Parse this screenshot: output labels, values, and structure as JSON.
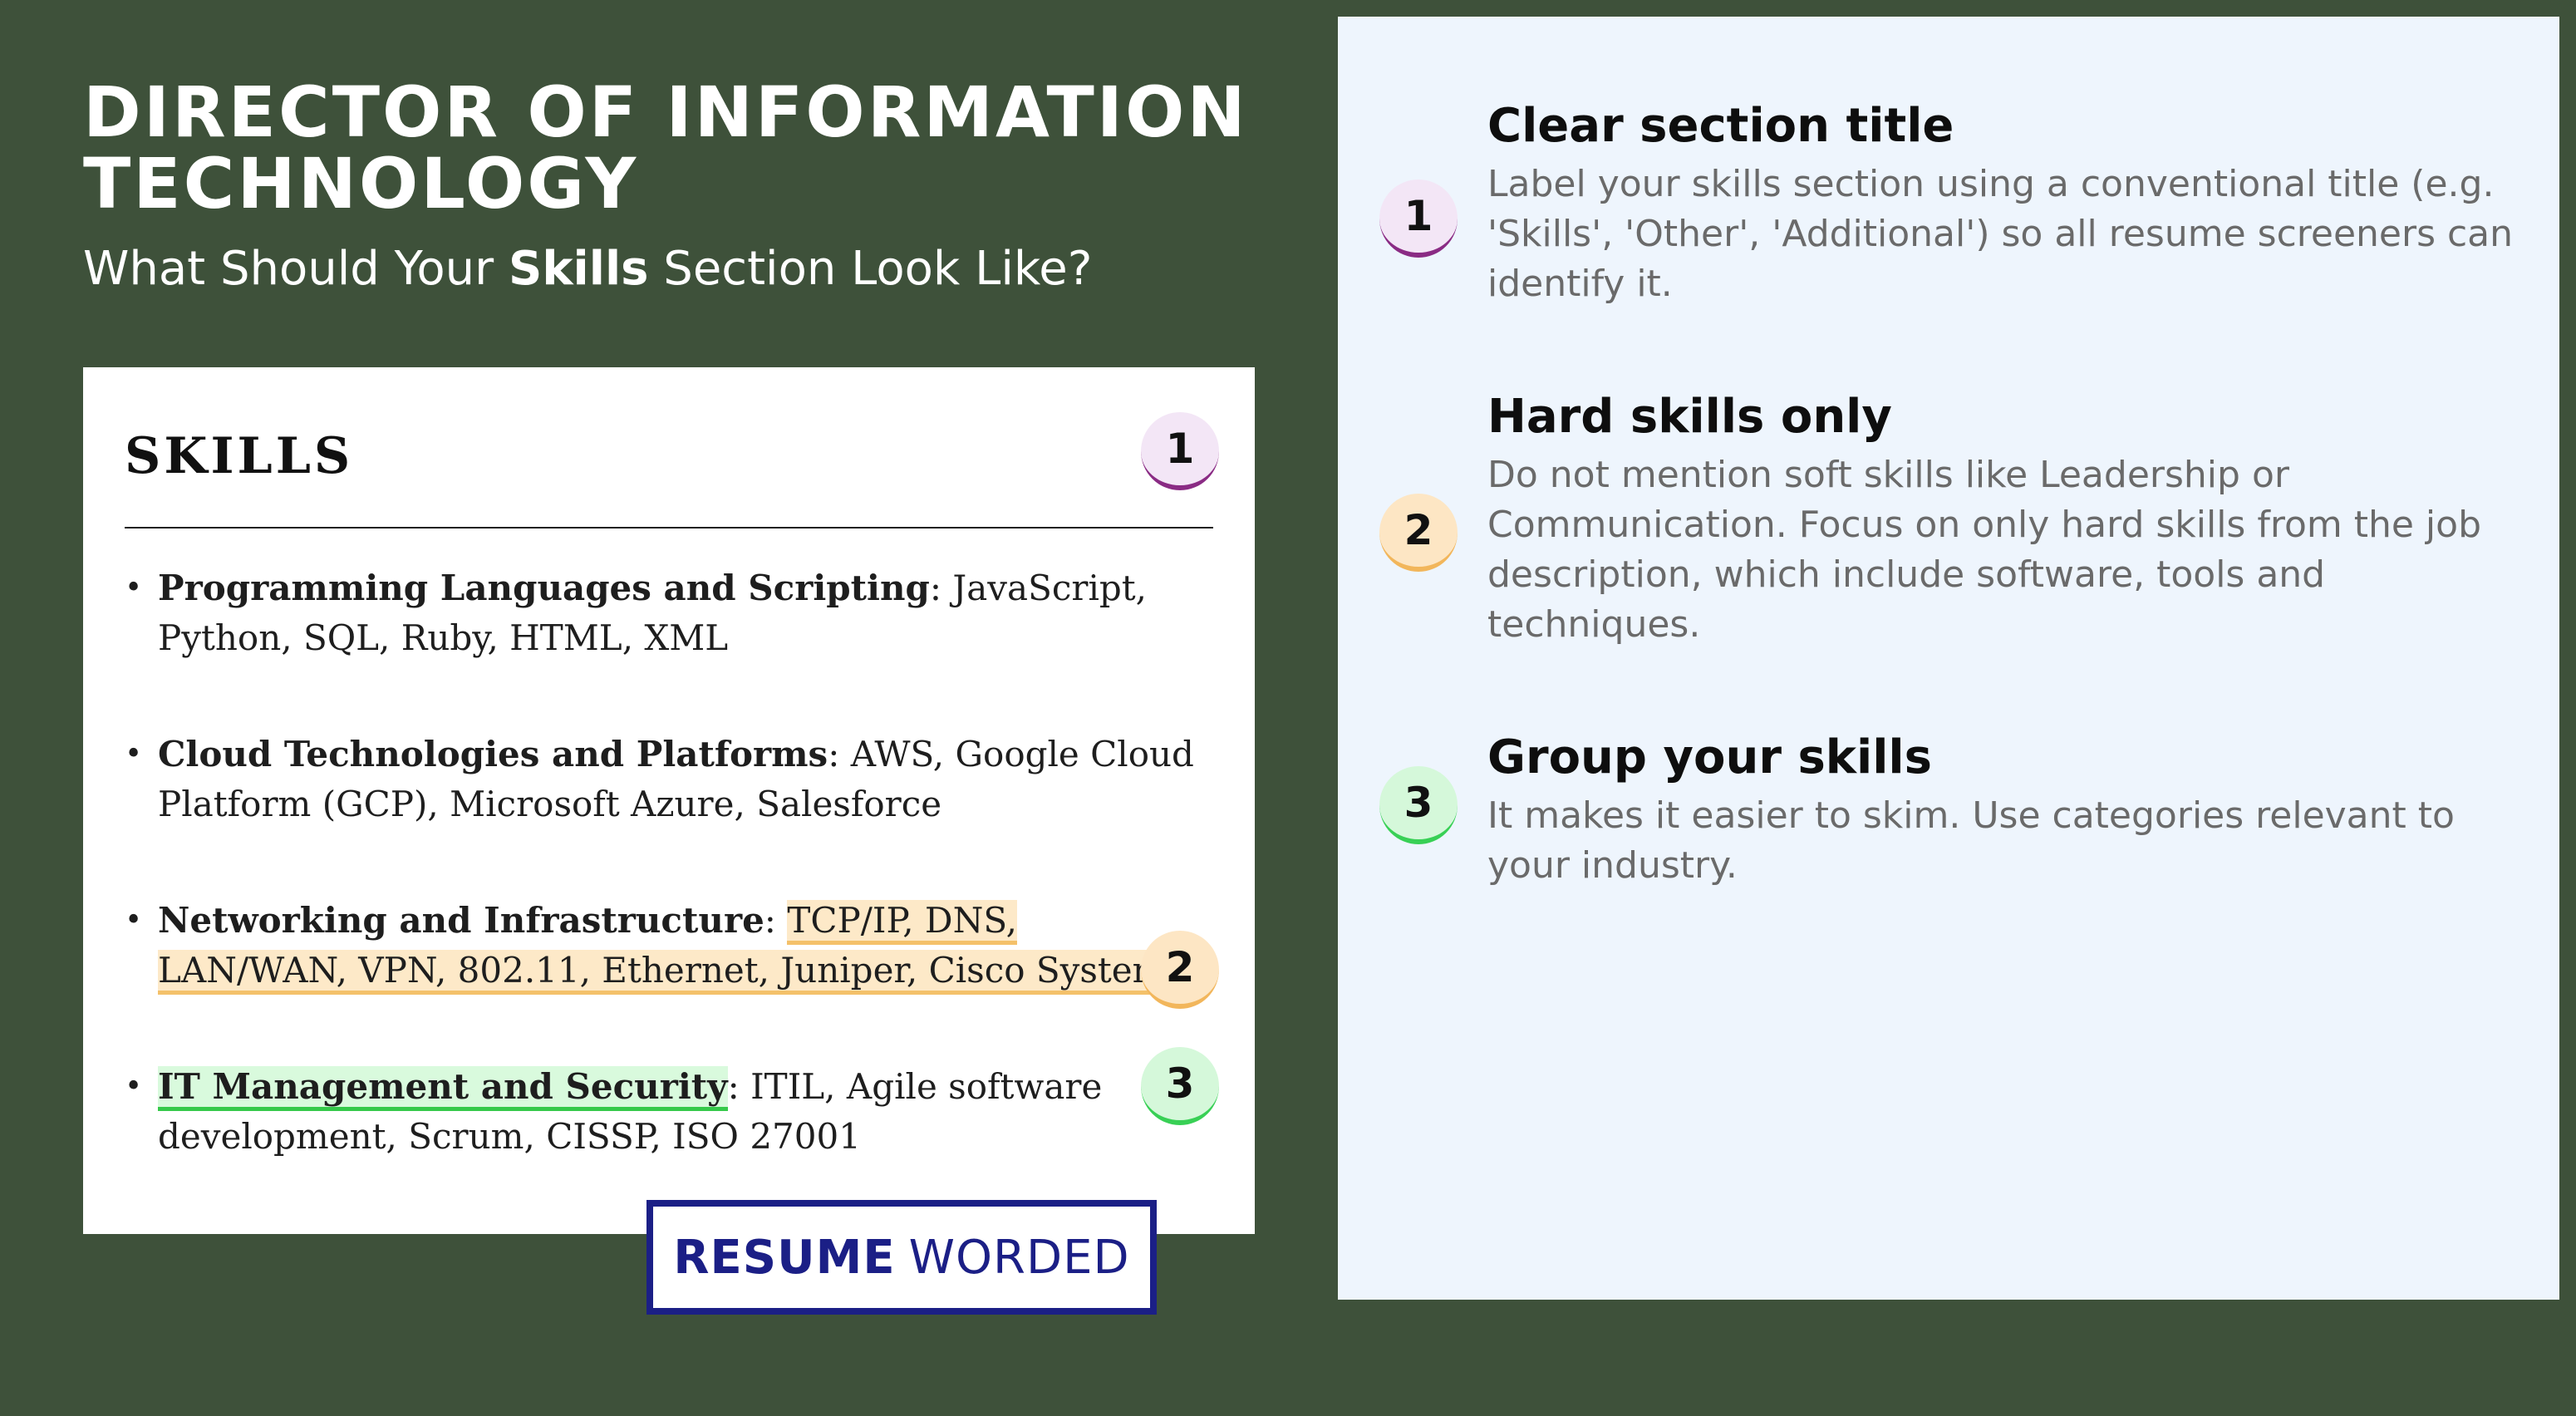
{
  "header": {
    "title": "DIRECTOR OF INFORMATION TECHNOLOGY",
    "subtitle_before": "What Should Your ",
    "subtitle_bold": "Skills",
    "subtitle_after": " Section Look Like?"
  },
  "resume": {
    "heading": "SKILLS",
    "items": [
      {
        "label": "Programming Languages and Scripting",
        "text": "JavaScript, Python, SQL, Ruby, HTML, XML"
      },
      {
        "label": "Cloud Technologies and Platforms",
        "text": "AWS, Google Cloud Platform (GCP), Microsoft Azure, Salesforce"
      },
      {
        "label": "Networking and Infrastructure",
        "text": "TCP/IP, DNS, LAN/WAN, VPN, 802.11, Ethernet, Juniper, Cisco Systems"
      },
      {
        "label": "IT Management and Security",
        "text": "ITIL, Agile software development, Scrum, CISSP, ISO 27001"
      }
    ],
    "separator": ": ",
    "bullet": "•"
  },
  "badges": [
    "1",
    "2",
    "3"
  ],
  "logo": {
    "bold": "RESUME",
    "light": "WORDED"
  },
  "tips": [
    {
      "title": "Clear section title",
      "body": "Label your skills section using a conventional title (e.g. 'Skills', 'Other', 'Additional') so all resume screeners can identify it."
    },
    {
      "title": "Hard skills only",
      "body": "Do not mention soft skills like Leadership or Communication. Focus on only hard skills from the job description, which include software, tools and techniques."
    },
    {
      "title": "Group your skills",
      "body": "It makes it easier to skim. Use categories relevant to your industry."
    }
  ],
  "colors": {
    "background": "#3e513a",
    "panel": "#eef5fd",
    "logo": "#1b1f86",
    "badge_1": "#8a2b84",
    "badge_2": "#f2b65b",
    "badge_3": "#38d055"
  }
}
